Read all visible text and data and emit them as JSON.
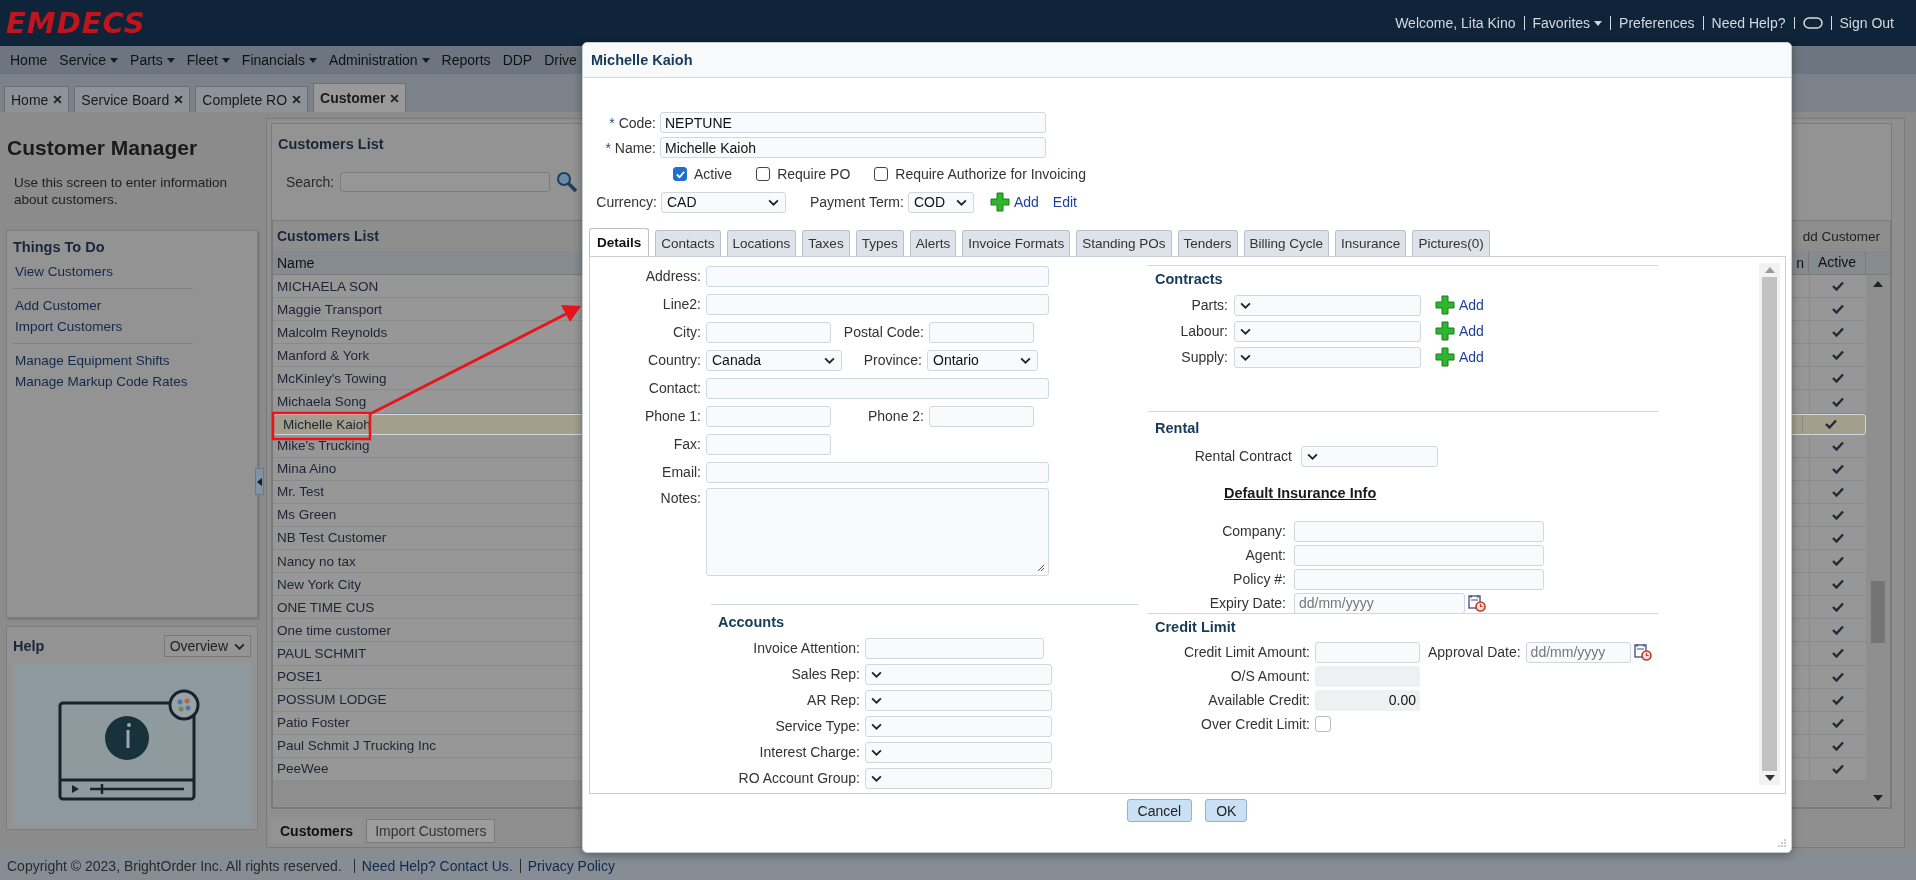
{
  "header": {
    "logo": "EMDECS",
    "items": [
      {
        "kind": "text",
        "text": "Welcome, Lita Kino"
      },
      {
        "kind": "menu",
        "text": "Favorites"
      },
      {
        "kind": "link",
        "text": "Preferences"
      },
      {
        "kind": "link",
        "text": "Need Help?"
      },
      {
        "kind": "icon"
      },
      {
        "kind": "link",
        "text": "Sign Out"
      }
    ]
  },
  "menu": [
    {
      "label": "Home",
      "dropdown": false
    },
    {
      "label": "Service",
      "dropdown": true
    },
    {
      "label": "Parts",
      "dropdown": true
    },
    {
      "label": "Fleet",
      "dropdown": true
    },
    {
      "label": "Financials",
      "dropdown": true
    },
    {
      "label": "Administration",
      "dropdown": true
    },
    {
      "label": "Reports",
      "dropdown": false
    },
    {
      "label": "DDP",
      "dropdown": false
    },
    {
      "label": "Drive",
      "dropdown": false
    }
  ],
  "tabs": [
    {
      "label": "Home",
      "selected": false
    },
    {
      "label": "Service Board",
      "selected": false
    },
    {
      "label": "Complete RO",
      "selected": false
    },
    {
      "label": "Customer",
      "selected": true
    }
  ],
  "sidebar": {
    "title": "Customer Manager",
    "description": "Use this screen to enter information about customers.",
    "todo_title": "Things To Do",
    "todo_groups": [
      [
        "View Customers"
      ],
      [
        "Add Customer",
        "Import Customers"
      ],
      [
        "Manage Equipment Shifts",
        "Manage Markup Code Rates"
      ]
    ],
    "help_title": "Help",
    "help_select": "Overview"
  },
  "list": {
    "title": "Customers List",
    "search_label": "Search:",
    "grid_title": "Customers List",
    "add_button": "dd Customer",
    "columns": [
      "Name",
      "n",
      "Active"
    ],
    "rows": [
      {
        "name": "MICHAELA SON",
        "active": true,
        "selected": false
      },
      {
        "name": "Maggie Transport",
        "active": true,
        "selected": false
      },
      {
        "name": "Malcolm Reynolds",
        "active": true,
        "selected": false
      },
      {
        "name": "Manford & York",
        "active": true,
        "selected": false
      },
      {
        "name": "McKinley's Towing",
        "active": true,
        "selected": false
      },
      {
        "name": "Michaela Song",
        "active": true,
        "selected": false
      },
      {
        "name": "Michelle Kaioh",
        "active": true,
        "selected": true
      },
      {
        "name": "Mike's Trucking",
        "active": true,
        "selected": false
      },
      {
        "name": "Mina Aino",
        "active": true,
        "selected": false
      },
      {
        "name": "Mr. Test",
        "active": true,
        "selected": false
      },
      {
        "name": "Ms Green",
        "active": true,
        "selected": false
      },
      {
        "name": "NB Test Customer",
        "active": true,
        "selected": false
      },
      {
        "name": "Nancy no tax",
        "active": true,
        "selected": false
      },
      {
        "name": "New York City",
        "active": true,
        "selected": false
      },
      {
        "name": "ONE TIME CUS",
        "active": true,
        "selected": false
      },
      {
        "name": "One time customer",
        "active": true,
        "selected": false
      },
      {
        "name": "PAUL SCHMIT",
        "active": true,
        "selected": false
      },
      {
        "name": "POSE1",
        "active": true,
        "selected": false
      },
      {
        "name": "POSSUM LODGE",
        "active": true,
        "selected": false
      },
      {
        "name": "Patio Foster",
        "active": true,
        "selected": false
      },
      {
        "name": "Paul Schmit J Trucking Inc",
        "active": true,
        "selected": false
      },
      {
        "name": "PeeWee",
        "active": true,
        "selected": false
      }
    ]
  },
  "bottom_tabs": [
    {
      "label": "Customers",
      "selected": true
    },
    {
      "label": "Import Customers",
      "selected": false
    }
  ],
  "footer": {
    "copyright": "Copyright © 2023, BrightOrder Inc. All rights reserved.",
    "links": [
      "Need Help? Contact Us.",
      "Privacy Policy"
    ]
  },
  "dialog": {
    "title": "Michelle Kaioh",
    "code": {
      "mark": "*",
      "label": "Code:",
      "value": "NEPTUNE"
    },
    "name": {
      "mark": "*",
      "label": "Name:",
      "value": "Michelle Kaioh"
    },
    "checks": [
      {
        "label": "Active",
        "checked": true
      },
      {
        "label": "Require PO",
        "checked": false
      },
      {
        "label": "Require Authorize for Invoicing",
        "checked": false
      }
    ],
    "currency": {
      "label": "Currency:",
      "value": "CAD"
    },
    "payment_term": {
      "label": "Payment Term:",
      "value": "COD"
    },
    "add": "Add",
    "edit": "Edit",
    "tabs": [
      {
        "label": "Details",
        "selected": true
      },
      {
        "label": "Contacts",
        "selected": false
      },
      {
        "label": "Locations",
        "selected": false
      },
      {
        "label": "Taxes",
        "selected": false
      },
      {
        "label": "Types",
        "selected": false
      },
      {
        "label": "Alerts",
        "selected": false
      },
      {
        "label": "Invoice Formats",
        "selected": false
      },
      {
        "label": "Standing POs",
        "selected": false
      },
      {
        "label": "Tenders",
        "selected": false
      },
      {
        "label": "Billing Cycle",
        "selected": false
      },
      {
        "label": "Insurance",
        "selected": false
      },
      {
        "label": "Pictures(0)",
        "selected": false
      }
    ],
    "address": [
      {
        "label": "Address:",
        "kind": "long"
      },
      {
        "label": "Line2:",
        "kind": "long"
      },
      {
        "label": "City:",
        "kind": "short",
        "pair": {
          "label": "Postal Code:",
          "kind": "short"
        }
      },
      {
        "label": "Country:",
        "kind": "select",
        "value": "Canada",
        "pair": {
          "label": "Province:",
          "kind": "select",
          "value": "Ontario"
        }
      },
      {
        "label": "Contact:",
        "kind": "long"
      },
      {
        "label": "Phone 1:",
        "kind": "short",
        "pair": {
          "label": "Phone 2:",
          "kind": "short"
        }
      },
      {
        "label": "Fax:",
        "kind": "short"
      },
      {
        "label": "Email:",
        "kind": "long"
      },
      {
        "label": "Notes:",
        "kind": "notes"
      }
    ],
    "accounts": {
      "title": "Accounts",
      "rows": [
        {
          "label": "Invoice Attention:",
          "kind": "text"
        },
        {
          "label": "Sales Rep:",
          "kind": "select"
        },
        {
          "label": "AR Rep:",
          "kind": "select"
        },
        {
          "label": "Service Type:",
          "kind": "select"
        },
        {
          "label": "Interest Charge:",
          "kind": "select"
        },
        {
          "label": "RO Account Group:",
          "kind": "select"
        }
      ]
    },
    "contracts": {
      "title": "Contracts",
      "rows": [
        {
          "label": "Parts:",
          "action": "Add"
        },
        {
          "label": "Labour:",
          "action": "Add"
        },
        {
          "label": "Supply:",
          "action": "Add"
        }
      ]
    },
    "rental": {
      "title": "Rental",
      "contract_label": "Rental Contract",
      "insurance_title": "Default Insurance Info",
      "fields": [
        {
          "label": "Company:",
          "kind": "text"
        },
        {
          "label": "Agent:",
          "kind": "text"
        },
        {
          "label": "Policy #:",
          "kind": "text"
        },
        {
          "label": "Expiry Date:",
          "kind": "date",
          "placeholder": "dd/mm/yyyy"
        }
      ]
    },
    "credit": {
      "title": "Credit Limit",
      "amount_label": "Credit Limit Amount:",
      "approval_label": "Approval Date:",
      "approval_placeholder": "dd/mm/yyyy",
      "os_label": "O/S Amount:",
      "available_label": "Available Credit:",
      "available_value": "0.00",
      "over_label": "Over Credit Limit:",
      "over_checked": false
    },
    "buttons": [
      "Cancel",
      "OK"
    ]
  }
}
